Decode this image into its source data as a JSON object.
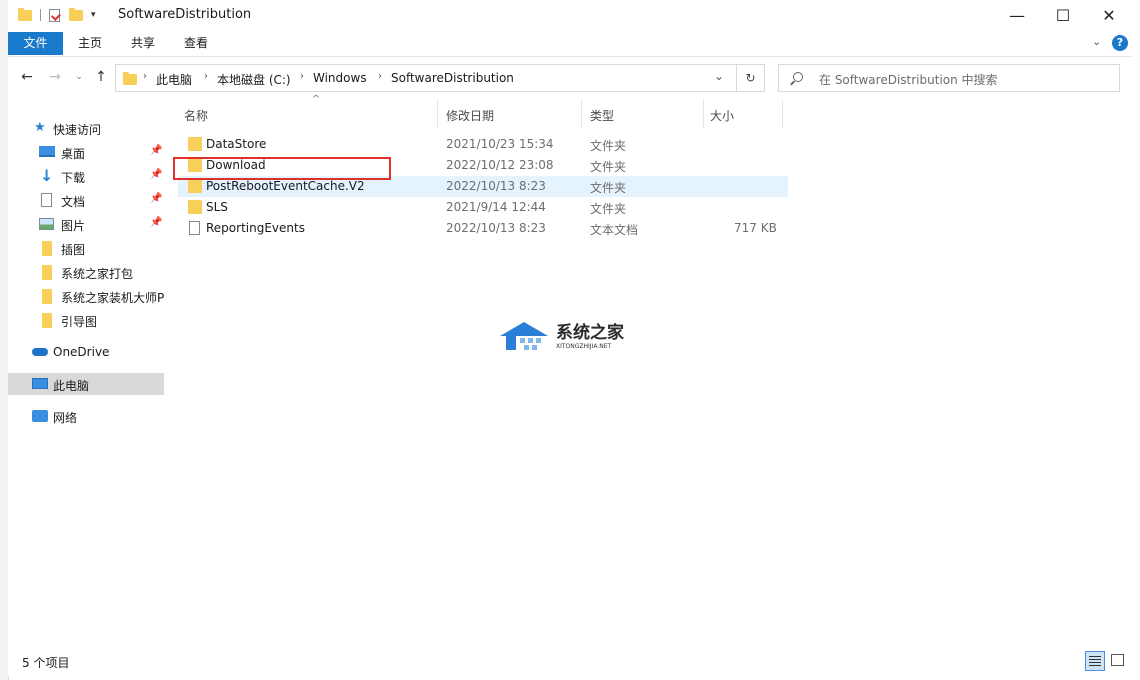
{
  "window": {
    "title": "SoftwareDistribution",
    "min_glyph": "—",
    "max_glyph": "☐",
    "close_glyph": "✕"
  },
  "ribbon": {
    "tabs": [
      "文件",
      "主页",
      "共享",
      "查看"
    ]
  },
  "address": {
    "segments": [
      "此电脑",
      "本地磁盘 (C:)",
      "Windows",
      "SoftwareDistribution"
    ]
  },
  "search": {
    "placeholder": "在 SoftwareDistribution 中搜索"
  },
  "sidebar": {
    "quick_access": "快速访问",
    "items": [
      {
        "label": "桌面",
        "pinned": true,
        "icon": "desktop-icon"
      },
      {
        "label": "下载",
        "pinned": true,
        "icon": "download-arrow-icon"
      },
      {
        "label": "文档",
        "pinned": true,
        "icon": "document-icon"
      },
      {
        "label": "图片",
        "pinned": true,
        "icon": "picture-icon"
      },
      {
        "label": "插图",
        "pinned": false,
        "icon": "folder-icon"
      },
      {
        "label": "系统之家打包",
        "pinned": false,
        "icon": "folder-icon"
      },
      {
        "label": "系统之家装机大师P",
        "pinned": false,
        "icon": "folder-icon"
      },
      {
        "label": "引导图",
        "pinned": false,
        "icon": "folder-icon"
      }
    ],
    "onedrive": "OneDrive",
    "this_pc": "此电脑",
    "network": "网络"
  },
  "columns": [
    "名称",
    "修改日期",
    "类型",
    "大小"
  ],
  "files": [
    {
      "name": "DataStore",
      "date": "2021/10/23 15:34",
      "type": "文件夹",
      "size": "",
      "icon": "folder-icon"
    },
    {
      "name": "Download",
      "date": "2022/10/12 23:08",
      "type": "文件夹",
      "size": "",
      "icon": "folder-icon"
    },
    {
      "name": "PostRebootEventCache.V2",
      "date": "2022/10/13 8:23",
      "type": "文件夹",
      "size": "",
      "icon": "folder-icon"
    },
    {
      "name": "SLS",
      "date": "2021/9/14 12:44",
      "type": "文件夹",
      "size": "",
      "icon": "folder-icon"
    },
    {
      "name": "ReportingEvents",
      "date": "2022/10/13 8:23",
      "type": "文本文档",
      "size": "717 KB",
      "icon": "text-file-icon"
    }
  ],
  "watermark": {
    "title": "系统之家",
    "subtitle": "XITONGZHIJIA.NET"
  },
  "status": {
    "count": "5 个项目"
  },
  "colors": {
    "accent": "#1979ca",
    "folder": "#f7cf59",
    "highlight": "#e5f3ff",
    "red_box": "#e0302a"
  }
}
